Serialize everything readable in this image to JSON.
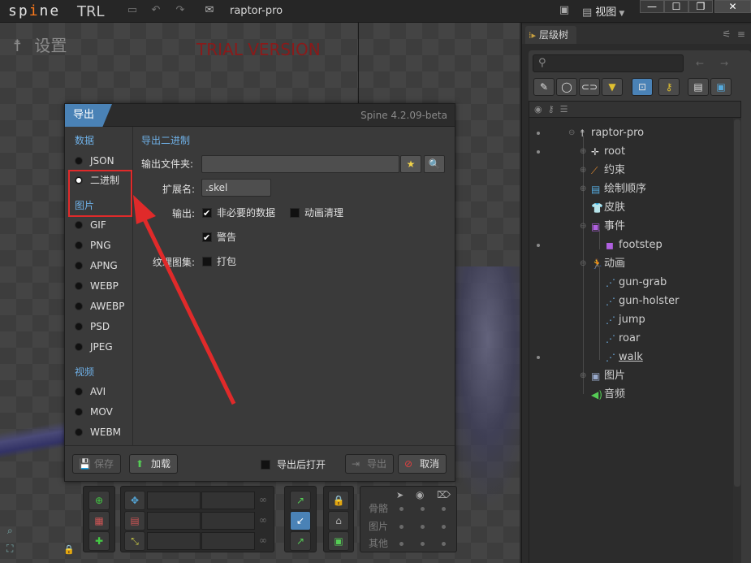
{
  "app": {
    "logo_main": "sp",
    "logo_accent": "i",
    "logo_end": "ne",
    "logo_sub": "TRL",
    "project_title": "raptor-pro",
    "view_label": "视图"
  },
  "viewport": {
    "settings_label": "设置",
    "trial_text": "TRIAL VERSION"
  },
  "dialog": {
    "tab_label": "导出",
    "version": "Spine 4.2.09-beta",
    "left": {
      "section_data": "数据",
      "data_options": [
        {
          "label": "JSON",
          "selected": false
        },
        {
          "label": "二进制",
          "selected": true
        }
      ],
      "section_images": "图片",
      "image_options": [
        "GIF",
        "PNG",
        "APNG",
        "WEBP",
        "AWEBP",
        "PSD",
        "JPEG"
      ],
      "section_video": "视频",
      "video_options": [
        "AVI",
        "MOV",
        "WEBM"
      ]
    },
    "right": {
      "title": "导出二进制",
      "output_folder_label": "输出文件夹:",
      "output_folder_value": "",
      "extension_label": "扩展名:",
      "extension_value": ".skel",
      "output_label": "输出:",
      "opt_nonessential": "非必要的数据",
      "opt_nonessential_checked": true,
      "opt_anim_cleanup": "动画清理",
      "opt_anim_cleanup_checked": false,
      "opt_warnings": "警告",
      "opt_warnings_checked": true,
      "atlas_label": "纹理图集:",
      "opt_pack": "打包",
      "opt_pack_checked": false
    },
    "footer": {
      "save": "保存",
      "load": "加载",
      "open_after_export": "导出后打开",
      "open_after_export_checked": false,
      "export": "导出",
      "cancel": "取消"
    }
  },
  "hierarchy": {
    "tab_label": "层级树",
    "search_placeholder": "",
    "items": [
      {
        "label": "raptor-pro",
        "icon": "skeleton-icon"
      },
      {
        "label": "root",
        "icon": "bone-icon"
      },
      {
        "label": "约束",
        "icon": "constraint-icon"
      },
      {
        "label": "绘制顺序",
        "icon": "draw-order-icon"
      },
      {
        "label": "皮肤",
        "icon": "skin-icon"
      },
      {
        "label": "事件",
        "icon": "event-icon"
      },
      {
        "label": "footstep",
        "icon": "event-item-icon"
      },
      {
        "label": "动画",
        "icon": "animation-icon"
      },
      {
        "label": "gun-grab",
        "icon": "animation-item-icon"
      },
      {
        "label": "gun-holster",
        "icon": "animation-item-icon"
      },
      {
        "label": "jump",
        "icon": "animation-item-icon"
      },
      {
        "label": "roar",
        "icon": "animation-item-icon"
      },
      {
        "label": "walk",
        "icon": "animation-item-icon"
      },
      {
        "label": "图片",
        "icon": "images-icon"
      },
      {
        "label": "音频",
        "icon": "audio-icon"
      }
    ]
  },
  "visibility_panel": {
    "row_bones": "骨骼",
    "row_images": "图片",
    "row_other": "其他"
  },
  "colors": {
    "accent_blue": "#4a82b6",
    "section_blue": "#6fb1e8",
    "annotation_red": "#e02a2a",
    "trial_red": "#8a1a1a"
  }
}
